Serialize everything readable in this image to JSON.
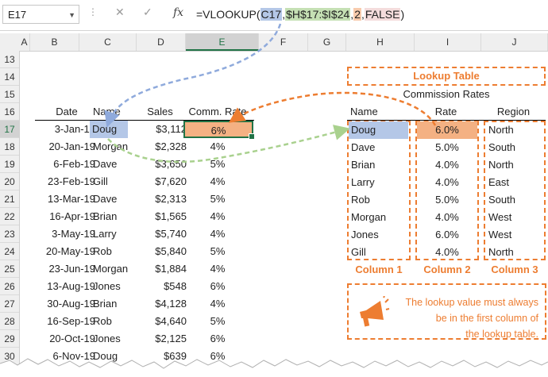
{
  "formula_bar": {
    "name_box": "E17",
    "fx": "fx",
    "cancel_glyph": "✕",
    "enter_glyph": "✓",
    "formula_parts": {
      "prefix": "=VLOOKUP(",
      "lookup_value": "C17",
      "sep1": ",",
      "table_array": "$H$17:$I$24",
      "sep2": ",",
      "col_index": "2",
      "sep3": ",",
      "range_lookup": "FALSE",
      "suffix": ")"
    }
  },
  "columns": [
    "A",
    "B",
    "C",
    "D",
    "E",
    "F",
    "G",
    "H",
    "I",
    "J"
  ],
  "row_numbers": [
    "13",
    "14",
    "15",
    "16",
    "17",
    "18",
    "19",
    "20",
    "21",
    "22",
    "23",
    "24",
    "25",
    "26",
    "27",
    "28",
    "29",
    "30"
  ],
  "headers": {
    "date": "Date",
    "name": "Name",
    "sales": "Sales",
    "rate": "Comm. Rate"
  },
  "sales_rows": [
    [
      "3-Jan-19",
      "Doug",
      "$3,112",
      "6%"
    ],
    [
      "20-Jan-19",
      "Morgan",
      "$2,328",
      "4%"
    ],
    [
      "6-Feb-19",
      "Dave",
      "$3,650",
      "5%"
    ],
    [
      "23-Feb-19",
      "Gill",
      "$7,620",
      "4%"
    ],
    [
      "13-Mar-19",
      "Dave",
      "$2,313",
      "5%"
    ],
    [
      "16-Apr-19",
      "Brian",
      "$1,565",
      "4%"
    ],
    [
      "3-May-19",
      "Larry",
      "$5,740",
      "4%"
    ],
    [
      "20-May-19",
      "Rob",
      "$5,840",
      "5%"
    ],
    [
      "23-Jun-19",
      "Morgan",
      "$1,884",
      "4%"
    ],
    [
      "13-Aug-19",
      "Jones",
      "$548",
      "6%"
    ],
    [
      "30-Aug-19",
      "Brian",
      "$4,128",
      "4%"
    ],
    [
      "16-Sep-19",
      "Rob",
      "$4,640",
      "5%"
    ],
    [
      "20-Oct-19",
      "Jones",
      "$2,125",
      "6%"
    ],
    [
      "6-Nov-19",
      "Doug",
      "$639",
      "6%"
    ]
  ],
  "lookup": {
    "title": "Lookup Table",
    "subtitle": "Commission Rates",
    "headers": {
      "name": "Name",
      "rate": "Rate",
      "region": "Region"
    },
    "rows": [
      [
        "Doug",
        "6.0%",
        "North"
      ],
      [
        "Dave",
        "5.0%",
        "South"
      ],
      [
        "Brian",
        "4.0%",
        "North"
      ],
      [
        "Larry",
        "4.0%",
        "East"
      ],
      [
        "Rob",
        "5.0%",
        "South"
      ],
      [
        "Morgan",
        "4.0%",
        "West"
      ],
      [
        "Jones",
        "6.0%",
        "West"
      ],
      [
        "Gill",
        "4.0%",
        "North"
      ]
    ],
    "col_labels": [
      "Column 1",
      "Column 2",
      "Column 3"
    ]
  },
  "note": {
    "line1": "The lookup value must always",
    "line2": "be in the first column of",
    "line3": "the lookup table."
  },
  "colors": {
    "accent_orange": "#ed7d31",
    "highlight_blue": "#b4c7e7",
    "highlight_green": "#c5e0b4",
    "highlight_orange": "#f4b183",
    "excel_green": "#217346"
  },
  "icons": [
    "chevron-down-icon",
    "cancel-icon",
    "enter-icon",
    "function-icon",
    "megaphone-icon"
  ]
}
